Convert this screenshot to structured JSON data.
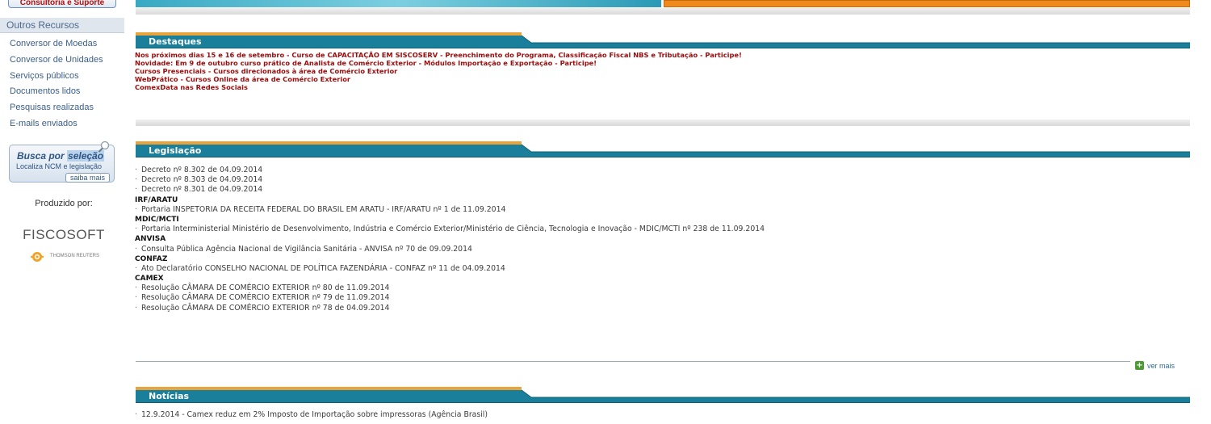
{
  "sidebar": {
    "support_button": "Consultoria e Suporte",
    "resources_header": "Outros Recursos",
    "resources": [
      "Conversor de Moedas",
      "Conversor de Unidades",
      "Serviços públicos",
      "Documentos lidos",
      "Pesquisas realizadas",
      "E-mails enviados"
    ],
    "busca": {
      "title_prefix": "Busca por ",
      "title_highlight": "seleção",
      "subtitle": "Localiza NCM e legislação",
      "button": "saiba mais"
    },
    "produced_by": "Produzido por:",
    "fiscosoft": "FISCOSOFT",
    "thomson": "THOMSON REUTERS"
  },
  "sections": {
    "destaques": {
      "title": "Destaques",
      "items": [
        "Nos próximos dias 15 e 16 de setembro - Curso de CAPACITAÇÃO EM SISCOSERV - Preenchimento do Programa, Classificação Fiscal NBS e Tributação - Participe!",
        "Novidade: Em 9 de outubro curso prático de Analista de Comércio Exterior - Módulos Importação e Exportação - Participe!",
        "Cursos Presenciais - Cursos direcionados à área de Comércio Exterior",
        "WebPrático - Cursos Online da área de Comércio Exterior",
        "ComexData nas Redes Sociais"
      ]
    },
    "legislacao": {
      "title": "Legislação",
      "lines": [
        {
          "type": "item",
          "text": "Decreto nº 8.302 de 04.09.2014"
        },
        {
          "type": "item",
          "text": "Decreto nº 8.303 de 04.09.2014"
        },
        {
          "type": "item",
          "text": "Decreto nº 8.301 de 04.09.2014"
        },
        {
          "type": "group",
          "text": "IRF/ARATU"
        },
        {
          "type": "item",
          "text": "Portaria INSPETORIA DA RECEITA FEDERAL DO BRASIL EM ARATU - IRF/ARATU nº 1 de 11.09.2014"
        },
        {
          "type": "group",
          "text": "MDIC/MCTI"
        },
        {
          "type": "item",
          "text": "Portaria Interministerial Ministério de Desenvolvimento, Indústria e Comércio Exterior/Ministério de Ciência, Tecnologia e Inovação - MDIC/MCTI nº 238 de 11.09.2014"
        },
        {
          "type": "group",
          "text": "ANVISA"
        },
        {
          "type": "item",
          "text": "Consulta Pública Agência Nacional de Vigilância Sanitária - ANVISA nº 70 de 09.09.2014"
        },
        {
          "type": "group",
          "text": "CONFAZ"
        },
        {
          "type": "item",
          "text": "Ato Declaratório CONSELHO NACIONAL DE POLÍTICA FAZENDÁRIA - CONFAZ nº 11 de 04.09.2014"
        },
        {
          "type": "group",
          "text": "CAMEX"
        },
        {
          "type": "item",
          "text": "Resolução CÂMARA DE COMÉRCIO EXTERIOR nº 80 de 11.09.2014"
        },
        {
          "type": "item",
          "text": "Resolução CÂMARA DE COMÉRCIO EXTERIOR nº 79 de 11.09.2014"
        },
        {
          "type": "item",
          "text": "Resolução CÂMARA DE COMÉRCIO EXTERIOR nº 78 de 04.09.2014"
        }
      ],
      "more_label": "ver mais"
    },
    "noticias": {
      "title": "Notícias",
      "items": [
        "12.9.2014 - Camex reduz em 2% Imposto de Importação sobre impressoras (Agência Brasil)"
      ]
    }
  },
  "colors": {
    "header_teal": "#1a7f9a",
    "header_orange": "#e8a33a",
    "highlight_red": "#a00c0c",
    "banner_orange": "#f08a1d"
  }
}
